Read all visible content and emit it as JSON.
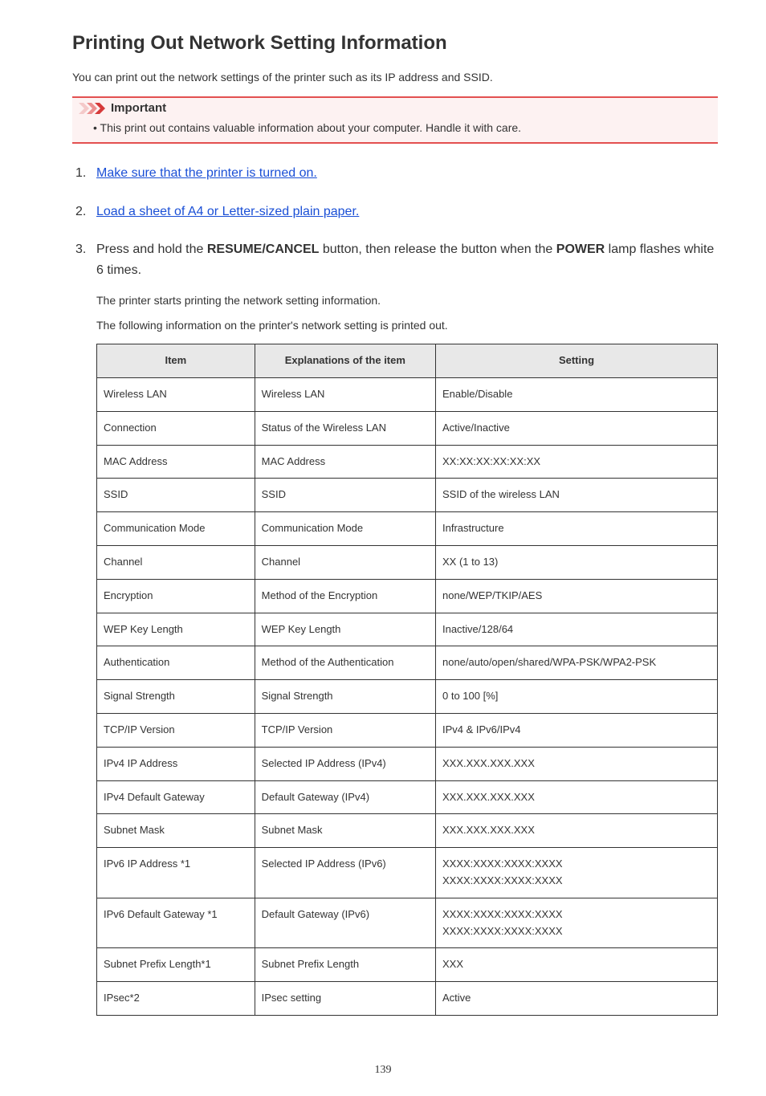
{
  "title": "Printing Out Network Setting Information",
  "intro": "You can print out the network settings of the printer such as its IP address and SSID.",
  "important": {
    "heading": "Important",
    "bullet_prefix": "• ",
    "text": "This print out contains valuable information about your computer. Handle it with care."
  },
  "steps": {
    "s1_link": "Make sure that the printer is turned on.",
    "s2_link": "Load a sheet of A4 or Letter-sized plain paper.",
    "s3_pre": "Press and hold the ",
    "s3_bold1": "RESUME/CANCEL",
    "s3_mid": " button, then release the button when the ",
    "s3_bold2": "POWER",
    "s3_post": " lamp flashes white 6 times.",
    "s3_sub1": "The printer starts printing the network setting information.",
    "s3_sub2": "The following information on the printer's network setting is printed out."
  },
  "table": {
    "headers": {
      "c1": "Item",
      "c2": "Explanations of the item",
      "c3": "Setting"
    },
    "rows": [
      {
        "c1": "Wireless LAN",
        "c2": "Wireless LAN",
        "c3": "Enable/Disable"
      },
      {
        "c1": "Connection",
        "c2": "Status of the Wireless LAN",
        "c3": "Active/Inactive"
      },
      {
        "c1": "MAC Address",
        "c2": "MAC Address",
        "c3": "XX:XX:XX:XX:XX:XX"
      },
      {
        "c1": "SSID",
        "c2": "SSID",
        "c3": "SSID of the wireless LAN"
      },
      {
        "c1": "Communication Mode",
        "c2": "Communication Mode",
        "c3": "Infrastructure"
      },
      {
        "c1": "Channel",
        "c2": "Channel",
        "c3": "XX (1 to 13)"
      },
      {
        "c1": "Encryption",
        "c2": "Method of the Encryption",
        "c3": "none/WEP/TKIP/AES"
      },
      {
        "c1": "WEP Key Length",
        "c2": "WEP Key Length",
        "c3": "Inactive/128/64"
      },
      {
        "c1": "Authentication",
        "c2": "Method of the Authentication",
        "c3": "none/auto/open/shared/WPA-PSK/WPA2-PSK"
      },
      {
        "c1": "Signal Strength",
        "c2": "Signal Strength",
        "c3": "0 to 100 [%]"
      },
      {
        "c1": "TCP/IP Version",
        "c2": "TCP/IP Version",
        "c3": "IPv4 & IPv6/IPv4"
      },
      {
        "c1": "IPv4 IP Address",
        "c2": "Selected IP Address (IPv4)",
        "c3": "XXX.XXX.XXX.XXX"
      },
      {
        "c1": "IPv4 Default Gateway",
        "c2": "Default Gateway (IPv4)",
        "c3": "XXX.XXX.XXX.XXX"
      },
      {
        "c1": "Subnet Mask",
        "c2": "Subnet Mask",
        "c3": "XXX.XXX.XXX.XXX"
      },
      {
        "c1": "IPv6 IP Address *1",
        "c2": "Selected IP Address (IPv6)",
        "c3": "XXXX:XXXX:XXXX:XXXX\nXXXX:XXXX:XXXX:XXXX"
      },
      {
        "c1": "IPv6 Default Gateway *1",
        "c2": "Default Gateway (IPv6)",
        "c3": "XXXX:XXXX:XXXX:XXXX\nXXXX:XXXX:XXXX:XXXX"
      },
      {
        "c1": "Subnet Prefix Length*1",
        "c2": "Subnet Prefix Length",
        "c3": "XXX"
      },
      {
        "c1": "IPsec*2",
        "c2": "IPsec setting",
        "c3": "Active"
      }
    ]
  },
  "page_number": "139"
}
